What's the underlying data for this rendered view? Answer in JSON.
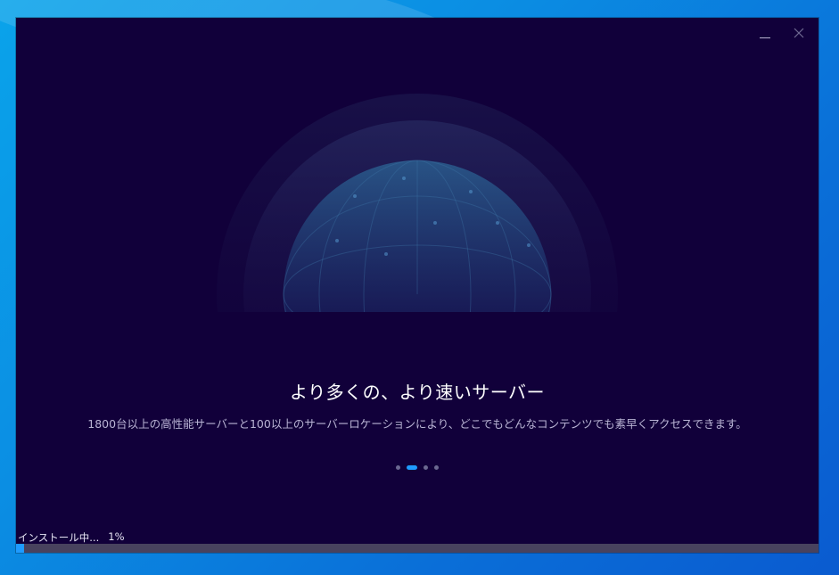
{
  "window": {
    "controls": [
      "minimize",
      "close"
    ]
  },
  "slide": {
    "title": "より多くの、より速いサーバー",
    "description": "1800台以上の高性能サーバーと100以上のサーバーロケーションにより、どこでもどんなコンテンツでも素早くアクセスできます。",
    "total": 4,
    "active_index": 1
  },
  "install": {
    "status_label": "インストール中...",
    "percent_label": "1%",
    "progress": 0.01
  },
  "colors": {
    "window_bg": "#11003a",
    "accent": "#1f9bff",
    "progress_track": "#48425e"
  },
  "icons": {
    "minimize": "minimize-icon",
    "close": "close-icon"
  }
}
